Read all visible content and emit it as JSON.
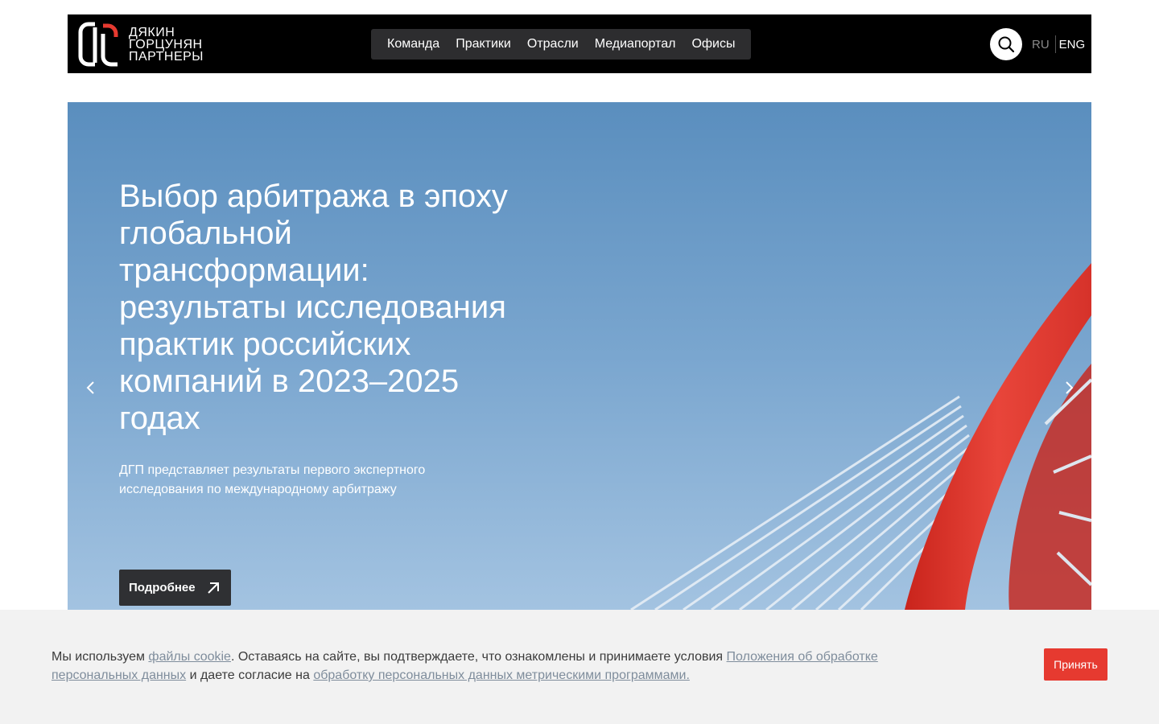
{
  "header": {
    "logo_lines": [
      "ДЯКИН",
      "ГОРЦУНЯН",
      "ПАРТНЕРЫ"
    ],
    "nav": [
      "Команда",
      "Практики",
      "Отрасли",
      "Медиапортал",
      "Офисы"
    ],
    "lang_ru": "RU",
    "lang_eng": "ENG"
  },
  "hero": {
    "title": "Выбор арбитража в эпоху глобальной трансформации: результаты исследования практик российских компаний в 2023–2025 годах",
    "subtitle": "ДГП представляет результаты первого экспертного исследования по международному арбитражу",
    "button_label": "Подробнее"
  },
  "cookie": {
    "text_1": "Мы используем ",
    "link_1": "файлы cookie",
    "text_2": ". Оставаясь на сайте, вы подтверждаете, что ознакомлены и принимаете условия ",
    "link_2": "Положения об обработке персональных данных",
    "text_3": " и даете согласие на ",
    "link_3": "обработку персональных данных метрическими программами.",
    "accept_label": "Принять"
  },
  "colors": {
    "accent": "#e63a30",
    "header_bg": "#000000",
    "sky": "#7aa6cf"
  },
  "icons": [
    "search-icon",
    "chevron-left-icon",
    "chevron-right-icon",
    "arrow-up-right-icon",
    "logo-mark-icon"
  ]
}
